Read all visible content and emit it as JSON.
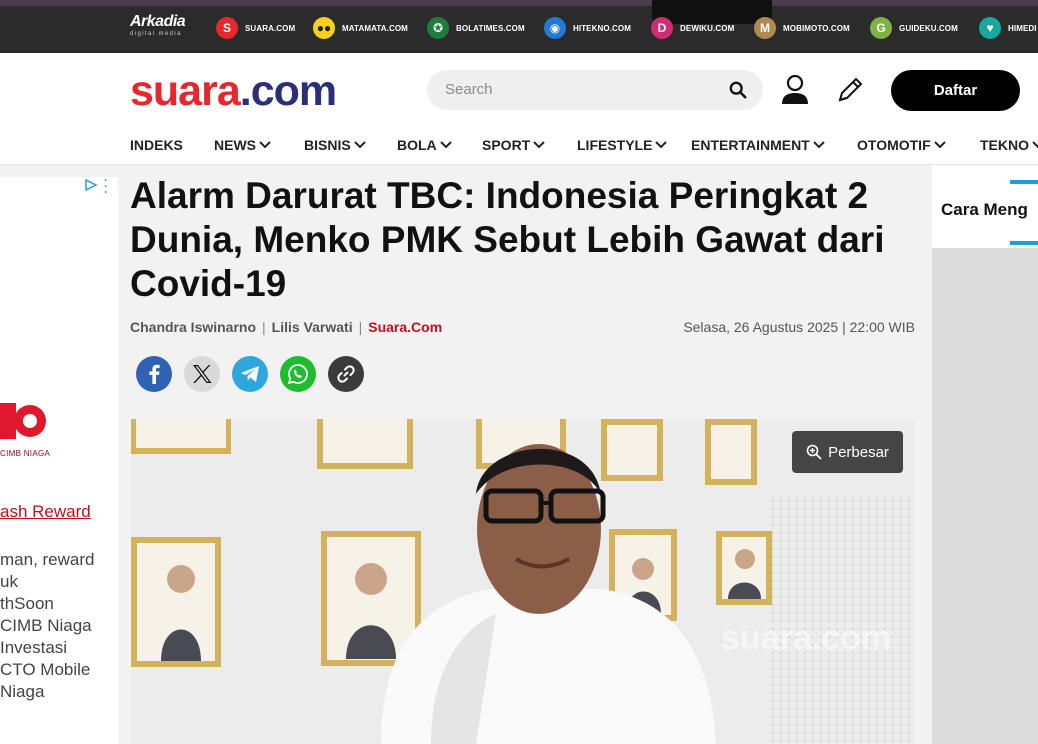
{
  "network": {
    "brand": "Arkadia",
    "brand_sub": "digital media",
    "sites": [
      {
        "label": "SUARA.COM",
        "icon": "s",
        "color": "#e6272d"
      },
      {
        "label": "MATAMATA.COM",
        "icon": "eyes",
        "color": "#f7d21a"
      },
      {
        "label": "BOLATIMES.COM",
        "icon": "ball",
        "color": "#1f7d3c"
      },
      {
        "label": "HITEKNO.COM",
        "icon": "h",
        "color": "#1f7ad8"
      },
      {
        "label": "DEWIKU.COM",
        "icon": "d",
        "color": "#d02c74"
      },
      {
        "label": "MOBIMOTO.COM",
        "icon": "m",
        "color": "#b08a50"
      },
      {
        "label": "GUIDEKU.COM",
        "icon": "g",
        "color": "#7cb342"
      },
      {
        "label": "HIMEDI",
        "icon": "heart",
        "color": "#17a8a0"
      }
    ]
  },
  "header": {
    "logo_part1": "suara",
    "logo_part2": ".com",
    "search_placeholder": "Search",
    "register_label": "Daftar"
  },
  "nav": [
    {
      "label": "INDEKS",
      "dropdown": false
    },
    {
      "label": "NEWS",
      "dropdown": true
    },
    {
      "label": "BISNIS",
      "dropdown": true
    },
    {
      "label": "BOLA",
      "dropdown": true
    },
    {
      "label": "SPORT",
      "dropdown": true
    },
    {
      "label": "LIFESTYLE",
      "dropdown": true
    },
    {
      "label": "ENTERTAINMENT",
      "dropdown": true
    },
    {
      "label": "OTOMOTIF",
      "dropdown": true
    },
    {
      "label": "TEKNO",
      "dropdown": true
    }
  ],
  "ad": {
    "logo_text": "TO",
    "sub_text": "CIMB NIAGA",
    "link_text": "ash Reward",
    "body_text": "man, reward\nuk\nthSoon\nCIMB Niaga\nInvestasi\nCTO Mobile\nNiaga"
  },
  "article": {
    "title": "Alarm Darurat TBC: Indonesia Peringkat 2 Dunia, Menko PMK Sebut Lebih Gawat dari Covid-19",
    "author1": "Chandra Iswinarno",
    "author2": "Lilis Varwati",
    "source": "Suara.Com",
    "date": "Selasa, 26 Agustus 2025 | 22:00 WIB",
    "zoom_label": "Perbesar",
    "watermark": "suara.com"
  },
  "share": [
    {
      "name": "facebook",
      "color": "#2f62b2"
    },
    {
      "name": "x",
      "color": "#d9d9d9"
    },
    {
      "name": "telegram",
      "color": "#2ea7df"
    },
    {
      "name": "whatsapp",
      "color": "#1ebd2e"
    },
    {
      "name": "copy-link",
      "color": "#3b3b3b"
    }
  ],
  "sidebar": {
    "card_text": "Cara Meng"
  }
}
